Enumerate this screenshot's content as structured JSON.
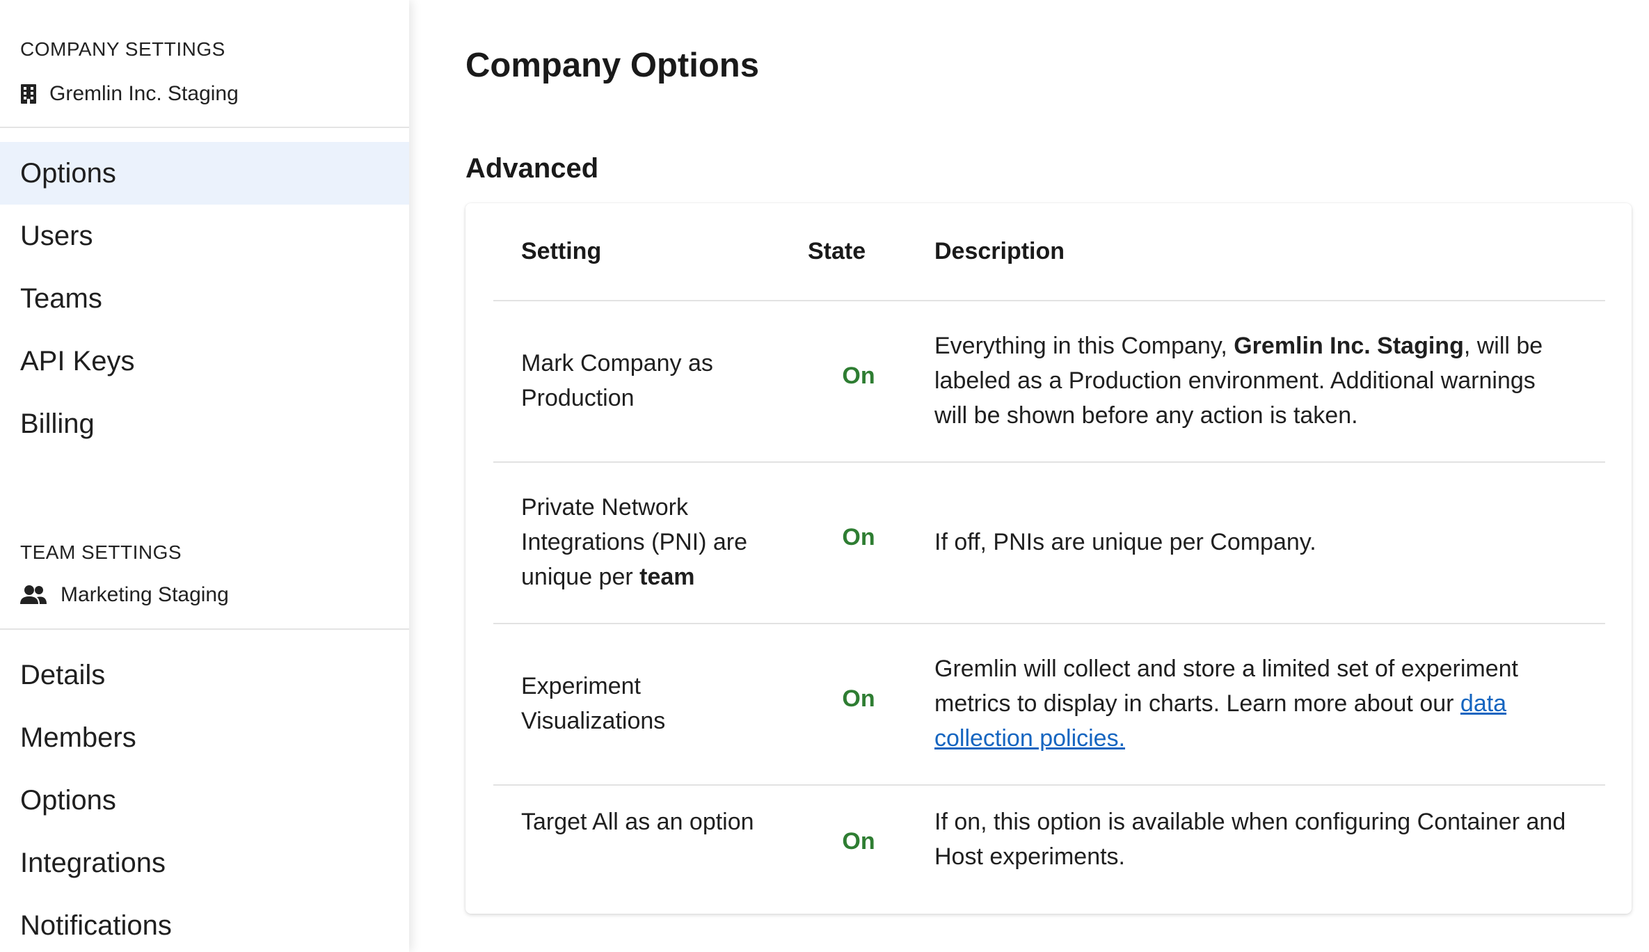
{
  "sidebar": {
    "company_heading": "COMPANY SETTINGS",
    "company_name": "Gremlin Inc. Staging",
    "company_items": [
      {
        "label": "Options",
        "active": true
      },
      {
        "label": "Users",
        "active": false
      },
      {
        "label": "Teams",
        "active": false
      },
      {
        "label": "API Keys",
        "active": false
      },
      {
        "label": "Billing",
        "active": false
      }
    ],
    "team_heading": "TEAM SETTINGS",
    "team_name": "Marketing Staging",
    "team_items": [
      {
        "label": "Details"
      },
      {
        "label": "Members"
      },
      {
        "label": "Options"
      },
      {
        "label": "Integrations"
      },
      {
        "label": "Notifications"
      }
    ]
  },
  "main": {
    "title": "Company Options",
    "section": "Advanced",
    "table": {
      "headers": {
        "setting": "Setting",
        "state": "State",
        "description": "Description"
      },
      "rows": [
        {
          "setting": "Mark Company as Production",
          "state": "On",
          "desc_pre": "Everything in this Company, ",
          "desc_bold": "Gremlin Inc. Staging",
          "desc_post": ", will be labeled as a Production environment. Additional warnings will be shown before any action is taken."
        },
        {
          "setting_pre": "Private Network Integrations (PNI) are unique per ",
          "setting_bold": "team",
          "state": "On",
          "desc": "If off, PNIs are unique per Company."
        },
        {
          "setting": "Experiment Visualizations",
          "state": "On",
          "desc_pre": "Gremlin will collect and store a limited set of experiment metrics to display in charts. Learn more about our ",
          "desc_link": "data collection policies."
        },
        {
          "setting": "Target All as an option",
          "state": "On",
          "desc": "If on, this option is available when configuring Container and Host experiments."
        }
      ]
    }
  },
  "colors": {
    "active_nav_bg": "#ebf2fc",
    "state_on": "#2e7d32",
    "link": "#1565c0"
  },
  "icons": {
    "company": "building-icon",
    "team": "people-icon"
  }
}
